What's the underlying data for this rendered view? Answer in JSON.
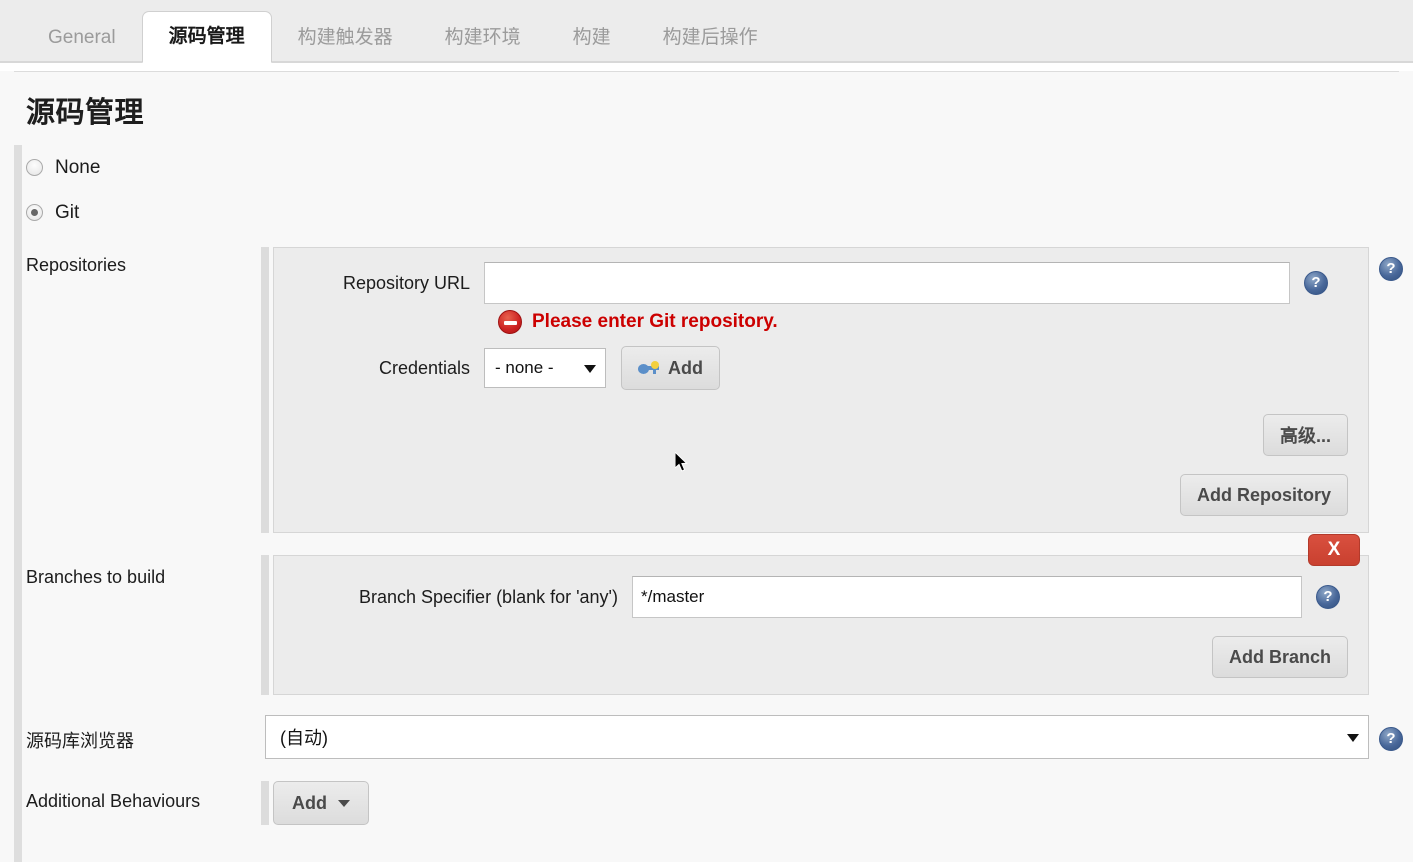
{
  "tabs": [
    {
      "label": "General",
      "active": false
    },
    {
      "label": "源码管理",
      "active": true
    },
    {
      "label": "构建触发器",
      "active": false
    },
    {
      "label": "构建环境",
      "active": false
    },
    {
      "label": "构建",
      "active": false
    },
    {
      "label": "构建后操作",
      "active": false
    }
  ],
  "page": {
    "title": "源码管理"
  },
  "scm_options": [
    {
      "label": "None",
      "selected": false
    },
    {
      "label": "Git",
      "selected": true
    }
  ],
  "repositories": {
    "row_label": "Repositories",
    "repository_url": {
      "label": "Repository URL",
      "value": "",
      "placeholder": ""
    },
    "error": {
      "icon": "error-circle-icon",
      "text": "Please enter Git repository."
    },
    "credentials": {
      "label": "Credentials",
      "selected": "- none -",
      "options": [
        "- none -"
      ],
      "add_button": "Add",
      "add_button_icon": "key-icon"
    },
    "advanced_button": "高级...",
    "add_repository_button": "Add Repository"
  },
  "branches": {
    "row_label": "Branches to build",
    "delete_button": "X",
    "branch_specifier": {
      "label": "Branch Specifier (blank for 'any')",
      "value": "*/master"
    },
    "add_branch_button": "Add Branch"
  },
  "repository_browser": {
    "row_label": "源码库浏览器",
    "selected": "(自动)",
    "options": [
      "(自动)"
    ]
  },
  "additional_behaviours": {
    "row_label": "Additional Behaviours",
    "add_button": "Add"
  },
  "colors": {
    "accent_error": "#cc0000",
    "delete_button": "#cc4436",
    "help_icon": "#49689a",
    "panel_bg": "#ececec",
    "page_bg": "#f8f8f8"
  }
}
